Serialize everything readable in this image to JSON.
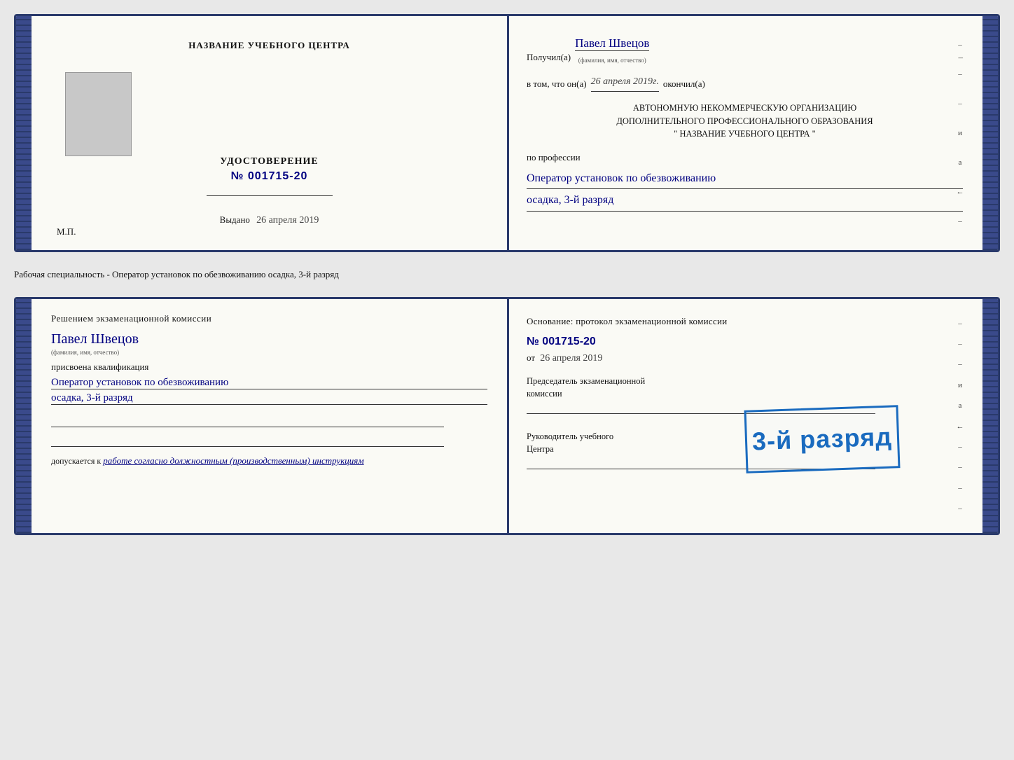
{
  "colors": {
    "border": "#2a3a6b",
    "handwriting": "#000080",
    "stamp": "#1a6bbf",
    "text": "#111111",
    "subtext": "#555555"
  },
  "top_document": {
    "left_page": {
      "center_title": "НАЗВАНИЕ УЧЕБНОГО ЦЕНТРА",
      "udostoverenie_label": "УДОСТОВЕРЕНИЕ",
      "number_prefix": "№",
      "number": "001715-20",
      "vydano_label": "Выдано",
      "vydano_date": "26 апреля 2019",
      "mp_label": "М.П."
    },
    "right_page": {
      "poluchil_prefix": "Получил(а)",
      "person_name": "Павел Швецов",
      "fio_subtitle": "(фамилия, имя, отчество)",
      "dash1": "–",
      "vtom_prefix": "в том, что он(а)",
      "vtom_date": "26 апреля 2019г.",
      "okoncil_label": "окончил(а)",
      "autonomous_line1": "АВТОНОМНУЮ НЕКОММЕРЧЕСКУЮ ОРГАНИЗАЦИЮ",
      "autonomous_line2": "ДОПОЛНИТЕЛЬНОГО ПРОФЕССИОНАЛЬНОГО ОБРАЗОВАНИЯ",
      "autonomous_line3": "\"  НАЗВАНИЕ УЧЕБНОГО ЦЕНТРА  \"",
      "po_professii_label": "по профессии",
      "profession_hw": "Оператор установок по обезвоживанию",
      "razryad_hw": "осадка, 3-й разряд"
    }
  },
  "separator": {
    "text": "Рабочая специальность - Оператор установок по обезвоживанию осадка, 3-й разряд"
  },
  "bottom_document": {
    "left_page": {
      "resheniyem_text": "Решением экзаменационной комиссии",
      "person_name": "Павел Швецов",
      "fio_subtitle": "(фамилия, имя, отчество)",
      "prisvoena_text": "присвоена квалификация",
      "profession_hw": "Оператор установок по обезвоживанию",
      "razryad_hw": "осадка, 3-й разряд",
      "dopuskaetsya_prefix": "допускается к",
      "dopusk_hw": "работе согласно должностным (производственным) инструкциям"
    },
    "right_page": {
      "osnovanie_text": "Основание: протокол экзаменационной комиссии",
      "number_prefix": "№",
      "protocol_number": "001715-20",
      "ot_prefix": "от",
      "ot_date": "26 апреля 2019",
      "predsedatel_line1": "Председатель экзаменационной",
      "predsedatel_line2": "комиссии",
      "rukovoditel_line1": "Руководитель учебного",
      "rukovoditel_line2": "Центра"
    },
    "stamp": {
      "text": "3-й разряд"
    }
  },
  "right_marks": {
    "marks": [
      "–",
      "–",
      "–",
      "и",
      "а",
      "←",
      "–",
      "–",
      "–",
      "–"
    ]
  }
}
